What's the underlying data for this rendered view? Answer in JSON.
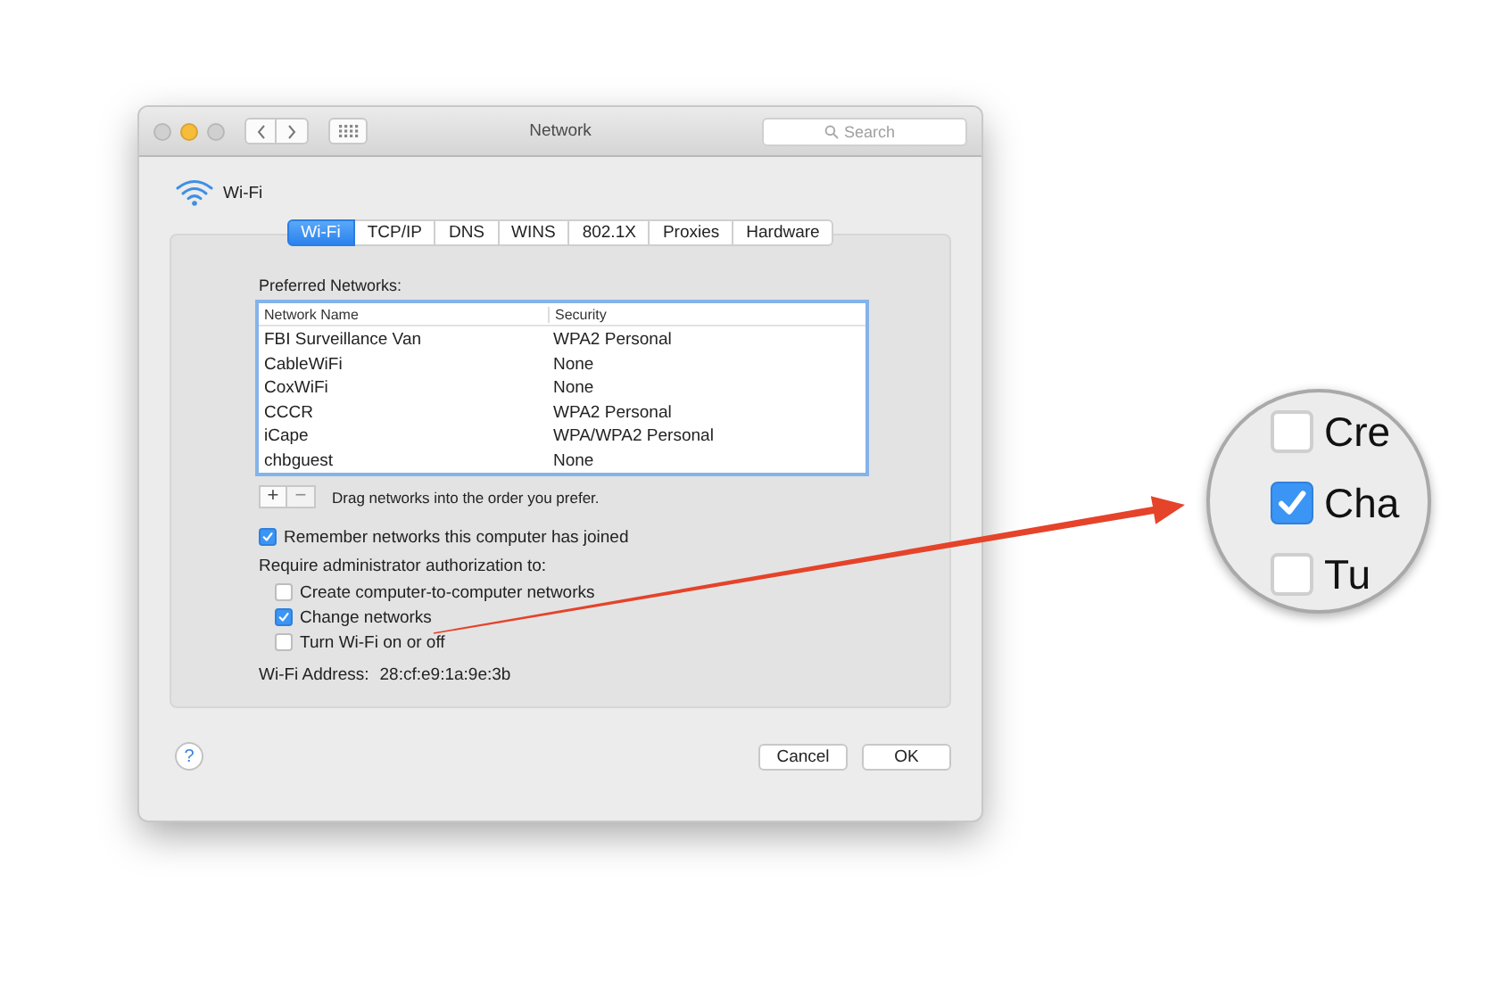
{
  "window": {
    "title": "Network",
    "search": {
      "placeholder": "Search"
    }
  },
  "service": {
    "name": "Wi-Fi"
  },
  "tabs": [
    {
      "label": "Wi-Fi",
      "selected": true
    },
    {
      "label": "TCP/IP",
      "selected": false
    },
    {
      "label": "DNS",
      "selected": false
    },
    {
      "label": "WINS",
      "selected": false
    },
    {
      "label": "802.1X",
      "selected": false
    },
    {
      "label": "Proxies",
      "selected": false
    },
    {
      "label": "Hardware",
      "selected": false
    }
  ],
  "preferred_networks": {
    "label": "Preferred Networks:",
    "columns": [
      "Network Name",
      "Security"
    ],
    "rows": [
      [
        "FBI Surveillance Van",
        "WPA2 Personal"
      ],
      [
        "CableWiFi",
        "None"
      ],
      [
        "CoxWiFi",
        "None"
      ],
      [
        "CCCR",
        "WPA2 Personal"
      ],
      [
        "iCape",
        "WPA/WPA2 Personal"
      ],
      [
        "chbguest",
        "None"
      ]
    ],
    "buttons": [
      {
        "label": "+",
        "disabled": false
      },
      {
        "label": "−",
        "disabled": true
      }
    ],
    "hint": "Drag networks into the order you prefer."
  },
  "remember": {
    "label": "Remember networks this computer has joined",
    "checked": true
  },
  "require_label": "Require administrator authorization to:",
  "require_options": [
    {
      "label": "Create computer-to-computer networks",
      "checked": false
    },
    {
      "label": "Change networks",
      "checked": true
    },
    {
      "label": "Turn Wi-Fi on or off",
      "checked": false
    }
  ],
  "address": {
    "label": "Wi-Fi Address:",
    "value": "28:cf:e9:1a:9e:3b"
  },
  "help_button": "?",
  "buttons": [
    "Cancel",
    "OK"
  ],
  "magnifier": {
    "items": [
      {
        "label": "Cre",
        "checked": false
      },
      {
        "label": "Cha",
        "checked": true
      },
      {
        "label": "Tu",
        "checked": false
      }
    ]
  }
}
